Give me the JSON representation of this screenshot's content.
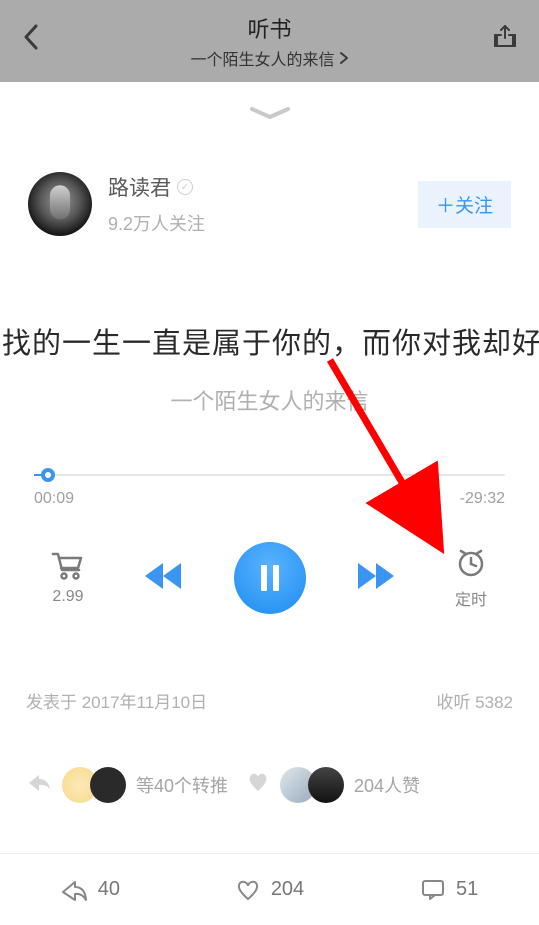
{
  "nav": {
    "title": "听书",
    "subtitle": "一个陌生女人的来信"
  },
  "author": {
    "name": "路读君",
    "followers": "9.2万人关注",
    "follow_label": "关注"
  },
  "track": {
    "title": "找的一生一直是属于你的，而你对我却好",
    "subtitle": "一个陌生女人的来信"
  },
  "progress": {
    "elapsed": "00:09",
    "remaining": "-29:32"
  },
  "controls": {
    "price": "2.99",
    "timer_label": "定时"
  },
  "meta": {
    "published": "发表于 2017年11月10日",
    "plays": "收听 5382"
  },
  "social": {
    "reposts": "等40个转推",
    "likes": "204人赞"
  },
  "bottom": {
    "share": "40",
    "like": "204",
    "comment": "51"
  }
}
